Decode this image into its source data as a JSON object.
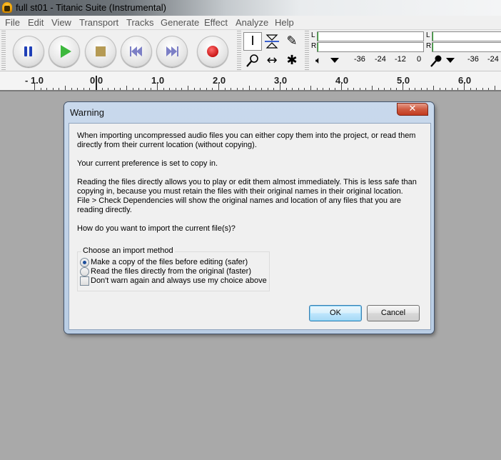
{
  "window": {
    "title": "full st01 - Titanic Suite (Instrumental)"
  },
  "menu": [
    "File",
    "Edit",
    "View",
    "Transport",
    "Tracks",
    "Generate",
    "Effect",
    "Analyze",
    "Help"
  ],
  "meters": {
    "playback": {
      "L": "L",
      "R": "R"
    },
    "record": {
      "L": "L",
      "R": "R"
    },
    "scale_left": [
      "-36",
      "-24",
      "-12",
      "0"
    ],
    "scale_right": [
      "-36",
      "-24"
    ]
  },
  "ruler": {
    "labels": [
      "- 1.0",
      "0.0",
      "1.0",
      "2.0",
      "3.0",
      "4.0",
      "5.0",
      "6.0"
    ]
  },
  "dialog": {
    "title": "Warning",
    "close": "✕",
    "p1": "When importing uncompressed audio files you can either copy them into the project, or read them directly from their current location (without copying).",
    "p2": "Your current preference is set to copy in.",
    "p3": "Reading the files directly allows you to play or edit them almost immediately.  This is less safe than copying in, because you must retain the files with their original names in their original location.",
    "p4": "File > Check Dependencies will show the original names and location of any files that you are reading directly.",
    "p5": "How do you want to import the current file(s)?",
    "group_label": "Choose an import method",
    "option_copy": "Make a copy of the files before editing (safer)",
    "option_read": "Read the files directly from the original (faster)",
    "option_dontwarn": "Don't warn again and always use my choice above",
    "ok": "OK",
    "cancel": "Cancel"
  }
}
